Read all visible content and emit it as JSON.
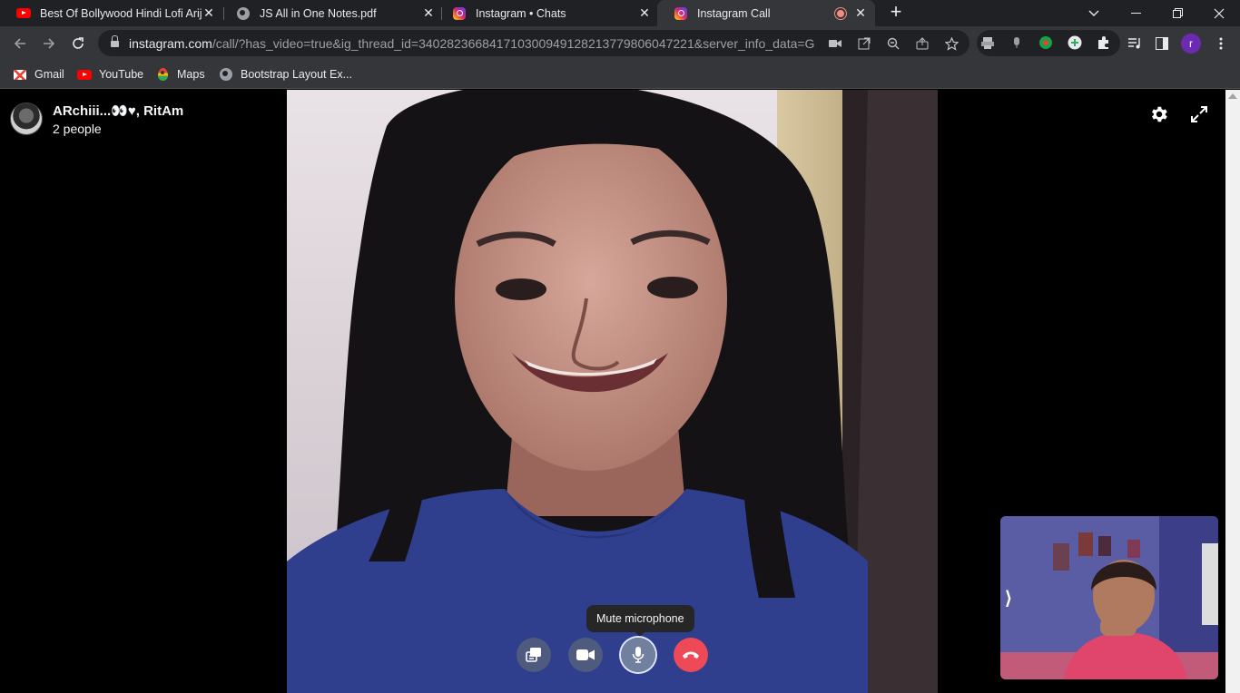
{
  "browser": {
    "tabs": [
      {
        "title": "Best Of Bollywood Hindi Lofi Arijit",
        "favicon": "youtube-icon",
        "active": false
      },
      {
        "title": "JS All in One Notes.pdf",
        "favicon": "globe-icon",
        "active": false
      },
      {
        "title": "Instagram • Chats",
        "favicon": "instagram-icon",
        "active": false
      },
      {
        "title": "Instagram Call",
        "favicon": "instagram-icon",
        "active": true,
        "recording": true
      }
    ],
    "address": {
      "host": "instagram.com",
      "path": "/call/?has_video=true&ig_thread_id=340282366841710300949128213779806047221&server_info_data=G..."
    },
    "profile_initial": "r",
    "bookmarks": [
      {
        "label": "Gmail",
        "icon": "gmail-icon"
      },
      {
        "label": "YouTube",
        "icon": "youtube-icon"
      },
      {
        "label": "Maps",
        "icon": "maps-icon"
      },
      {
        "label": "Bootstrap Layout Ex...",
        "icon": "globe-icon"
      }
    ]
  },
  "call": {
    "thread_name": "ARchiii...👀♥, RitAm",
    "participants": "2 people",
    "tooltip": "Mute microphone",
    "controls": [
      {
        "name": "screen-share",
        "label": "Share screen"
      },
      {
        "name": "camera",
        "label": "Turn off camera"
      },
      {
        "name": "microphone",
        "label": "Mute microphone"
      },
      {
        "name": "end-call",
        "label": "End call"
      }
    ],
    "colors": {
      "end_call": "#ed4956",
      "background": "#000000",
      "tab_active": "#35363a"
    }
  }
}
